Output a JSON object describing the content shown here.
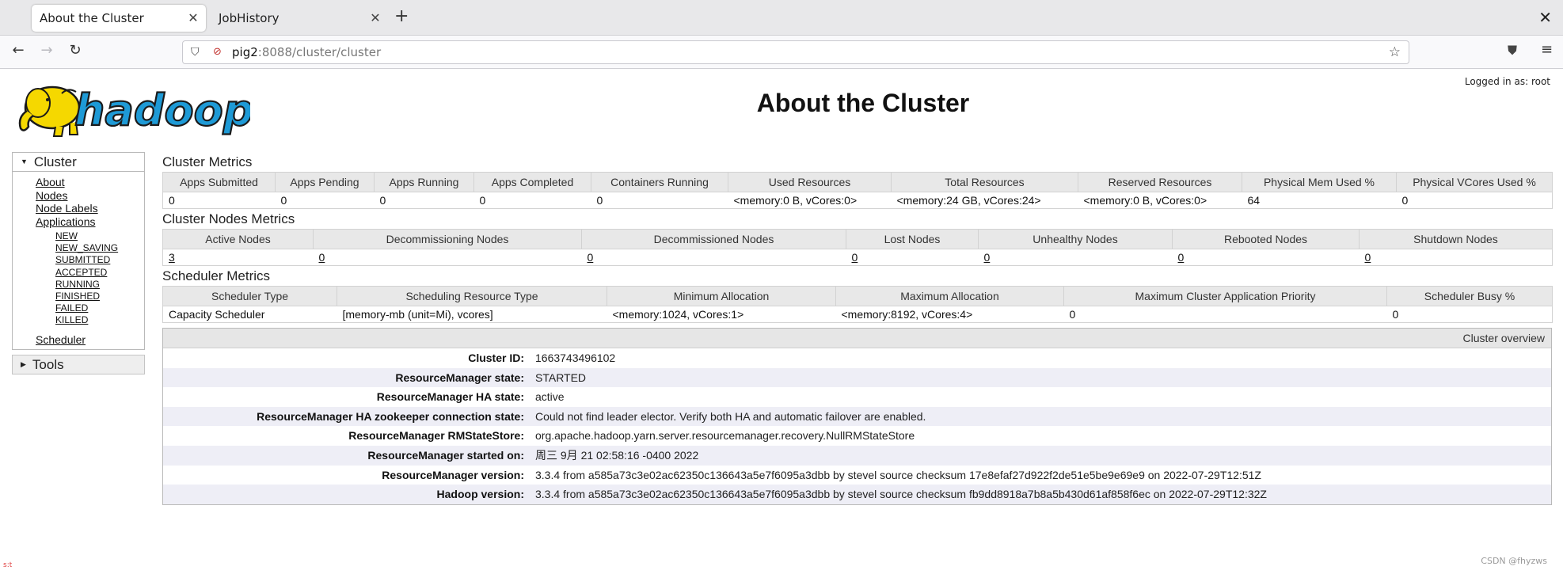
{
  "browser": {
    "tabs": [
      {
        "title": "About the Cluster",
        "active": true
      },
      {
        "title": "JobHistory",
        "active": false
      }
    ],
    "new_tab": "+",
    "url_host": "pig2",
    "url_path": ":8088/cluster/cluster",
    "icons": [
      "back-icon",
      "forward-icon",
      "reload-icon",
      "shield-icon",
      "lock-icon",
      "star-icon",
      "pocket-icon",
      "menu-icon",
      "close-icon"
    ]
  },
  "header": {
    "logged_in": "Logged in as: root",
    "title": "About the Cluster",
    "logo": "hadoop"
  },
  "sidebar": {
    "cluster_label": "Cluster",
    "cluster_links": [
      "About",
      "Nodes",
      "Node Labels",
      "Applications"
    ],
    "app_states": [
      "NEW",
      "NEW_SAVING",
      "SUBMITTED",
      "ACCEPTED",
      "RUNNING",
      "FINISHED",
      "FAILED",
      "KILLED"
    ],
    "scheduler_link": "Scheduler",
    "tools_label": "Tools"
  },
  "cluster_metrics": {
    "title": "Cluster Metrics",
    "headers": [
      "Apps Submitted",
      "Apps Pending",
      "Apps Running",
      "Apps Completed",
      "Containers Running",
      "Used Resources",
      "Total Resources",
      "Reserved Resources",
      "Physical Mem Used %",
      "Physical VCores Used %"
    ],
    "values": [
      "0",
      "0",
      "0",
      "0",
      "0",
      "<memory:0 B, vCores:0>",
      "<memory:24 GB, vCores:24>",
      "<memory:0 B, vCores:0>",
      "64",
      "0"
    ]
  },
  "node_metrics": {
    "title": "Cluster Nodes Metrics",
    "headers": [
      "Active Nodes",
      "Decommissioning Nodes",
      "Decommissioned Nodes",
      "Lost Nodes",
      "Unhealthy Nodes",
      "Rebooted Nodes",
      "Shutdown Nodes"
    ],
    "values": [
      "3",
      "0",
      "0",
      "0",
      "0",
      "0",
      "0"
    ]
  },
  "scheduler_metrics": {
    "title": "Scheduler Metrics",
    "headers": [
      "Scheduler Type",
      "Scheduling Resource Type",
      "Minimum Allocation",
      "Maximum Allocation",
      "Maximum Cluster Application Priority",
      "Scheduler Busy %"
    ],
    "values": [
      "Capacity Scheduler",
      "[memory-mb (unit=Mi), vcores]",
      "<memory:1024, vCores:1>",
      "<memory:8192, vCores:4>",
      "0",
      "0"
    ]
  },
  "overview": {
    "title": "Cluster overview",
    "rows": [
      {
        "key": "Cluster ID:",
        "value": "1663743496102"
      },
      {
        "key": "ResourceManager state:",
        "value": "STARTED"
      },
      {
        "key": "ResourceManager HA state:",
        "value": "active"
      },
      {
        "key": "ResourceManager HA zookeeper connection state:",
        "value": "Could not find leader elector. Verify both HA and automatic failover are enabled."
      },
      {
        "key": "ResourceManager RMStateStore:",
        "value": "org.apache.hadoop.yarn.server.resourcemanager.recovery.NullRMStateStore"
      },
      {
        "key": "ResourceManager started on:",
        "value": "周三 9月 21 02:58:16 -0400 2022"
      },
      {
        "key": "ResourceManager version:",
        "value": "3.3.4 from a585a73c3e02ac62350c136643a5e7f6095a3dbb by stevel source checksum 17e8efaf27d922f2de51e5be9e69e9 on 2022-07-29T12:51Z"
      },
      {
        "key": "Hadoop version:",
        "value": "3.3.4 from a585a73c3e02ac62350c136643a5e7f6095a3dbb by stevel source checksum fb9dd8918a7b8a5b430d61af858f6ec on 2022-07-29T12:32Z"
      }
    ]
  },
  "footer": {
    "watermark": "CSDN @fhyzws",
    "corner_mark": "s:t"
  },
  "colors": {
    "logo_yellow": "#f5d800",
    "logo_outline": "#1a1a1a",
    "logo_text_blue": "#1e9ad6",
    "row_stripe": "#eeeef6",
    "header_gray": "#e8e8e8"
  }
}
